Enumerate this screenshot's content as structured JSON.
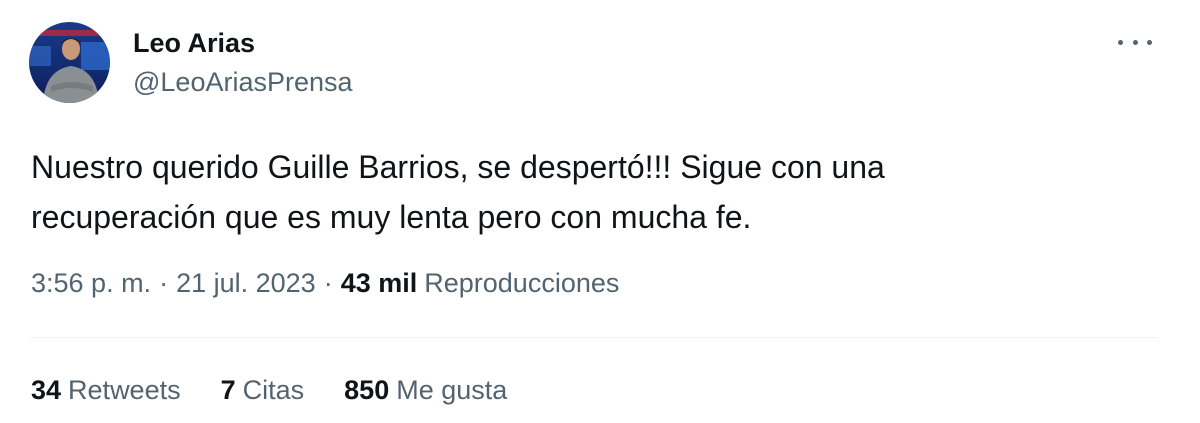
{
  "author": {
    "name": "Leo Arias",
    "handle": "@LeoAriasPrensa"
  },
  "tweet": {
    "lines": [
      "Nuestro querido Guille Barrios, se despertó!!! Sigue con una",
      "recuperación que es muy lenta pero con mucha fe."
    ],
    "time": "3:56 p. m.",
    "date": "21 jul. 2023",
    "separator": "·",
    "views_count": "43 mil",
    "views_label": "Reproducciones"
  },
  "stats": {
    "retweets_count": "34",
    "retweets_label": "Retweets",
    "quotes_count": "7",
    "quotes_label": "Citas",
    "likes_count": "850",
    "likes_label": "Me gusta"
  },
  "colors": {
    "text_primary": "#0f1419",
    "text_secondary": "#536471",
    "divider": "#eff3f4"
  },
  "icons": {
    "more": "more-horizontal-icon"
  }
}
